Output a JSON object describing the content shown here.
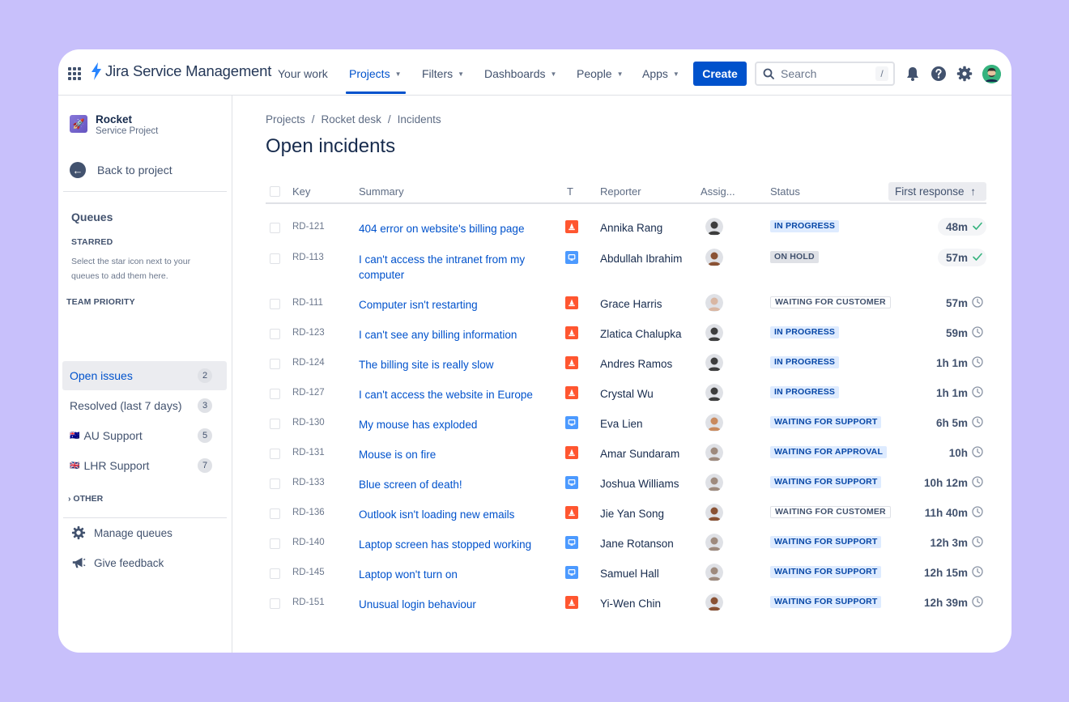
{
  "app": {
    "name": "Jira Service Management"
  },
  "nav": {
    "items": [
      {
        "label": "Your work",
        "caret": false,
        "active": false
      },
      {
        "label": "Projects",
        "caret": true,
        "active": true
      },
      {
        "label": "Filters",
        "caret": true,
        "active": false
      },
      {
        "label": "Dashboards",
        "caret": true,
        "active": false
      },
      {
        "label": "People",
        "caret": true,
        "active": false
      },
      {
        "label": "Apps",
        "caret": true,
        "active": false
      }
    ],
    "create_label": "Create",
    "search_placeholder": "Search",
    "search_shortcut": "/"
  },
  "sidebar": {
    "project_name": "Rocket",
    "project_type": "Service Project",
    "back_label": "Back to project",
    "queues_title": "Queues",
    "starred_caption": "STARRED",
    "starred_help": "Select the star icon next to your queues to add them here.",
    "team_priority_caption": "TEAM PRIORITY",
    "queues": [
      {
        "label": "Open issues",
        "count": "2",
        "flag": "",
        "selected": true
      },
      {
        "label": "Resolved (last 7 days)",
        "count": "3",
        "flag": "",
        "selected": false
      },
      {
        "label": "AU Support",
        "count": "5",
        "flag": "🇦🇺",
        "selected": false
      },
      {
        "label": "LHR Support",
        "count": "7",
        "flag": "🇬🇧",
        "selected": false
      }
    ],
    "other_label": "OTHER",
    "manage_label": "Manage queues",
    "feedback_label": "Give feedback"
  },
  "main": {
    "breadcrumb": [
      "Projects",
      "Rocket desk",
      "Incidents"
    ],
    "title": "Open incidents",
    "columns": {
      "key": "Key",
      "summary": "Summary",
      "type": "T",
      "reporter": "Reporter",
      "assignee": "Assig...",
      "status": "Status",
      "first_response": "First response"
    },
    "rows": [
      {
        "key": "RD-121",
        "summary": "404 error on website's billing page",
        "type": "incident",
        "reporter": "Annika Rang",
        "status": "IN PROGRESS",
        "status_style": "blue",
        "response": "48m",
        "met": true,
        "avatar": "#3d3d3d"
      },
      {
        "key": "RD-113",
        "summary": "I can't access the intranet from my computer",
        "type": "service",
        "reporter": "Abdullah Ibrahim",
        "status": "ON HOLD",
        "status_style": "grey",
        "response": "57m",
        "met": true,
        "avatar": "#8a5234"
      },
      {
        "key": "RD-111",
        "summary": "Computer isn't restarting",
        "type": "incident",
        "reporter": "Grace Harris",
        "status": "WAITING FOR CUSTOMER",
        "status_style": "outline",
        "response": "57m",
        "met": false,
        "avatar": "#d9b7a3"
      },
      {
        "key": "RD-123",
        "summary": "I can't see any billing information",
        "type": "incident",
        "reporter": "Zlatica Chalupka",
        "status": "IN PROGRESS",
        "status_style": "blue",
        "response": "59m",
        "met": false,
        "avatar": "#3d3d3d"
      },
      {
        "key": "RD-124",
        "summary": "The billing site is really slow",
        "type": "incident",
        "reporter": "Andres Ramos",
        "status": "IN PROGRESS",
        "status_style": "blue",
        "response": "1h 1m",
        "met": false,
        "avatar": "#3d3d3d"
      },
      {
        "key": "RD-127",
        "summary": "I can't access the website in Europe",
        "type": "incident",
        "reporter": "Crystal Wu",
        "status": "IN PROGRESS",
        "status_style": "blue",
        "response": "1h 1m",
        "met": false,
        "avatar": "#3d3d3d"
      },
      {
        "key": "RD-130",
        "summary": "My mouse has exploded",
        "type": "service",
        "reporter": "Eva Lien",
        "status": "WAITING FOR SUPPORT",
        "status_style": "blue",
        "response": "6h 5m",
        "met": false,
        "avatar": "#c98a5e"
      },
      {
        "key": "RD-131",
        "summary": "Mouse is on fire",
        "type": "incident",
        "reporter": "Amar Sundaram",
        "status": "WAITING FOR APPROVAL",
        "status_style": "blue",
        "response": "10h",
        "met": false,
        "avatar": "#9e8a7d"
      },
      {
        "key": "RD-133",
        "summary": "Blue screen of death!",
        "type": "service",
        "reporter": "Joshua Williams",
        "status": "WAITING FOR SUPPORT",
        "status_style": "blue",
        "response": "10h 12m",
        "met": false,
        "avatar": "#9e8a7d"
      },
      {
        "key": "RD-136",
        "summary": "Outlook isn't loading new emails",
        "type": "incident",
        "reporter": "Jie Yan Song",
        "status": "WAITING FOR CUSTOMER",
        "status_style": "outline",
        "response": "11h 40m",
        "met": false,
        "avatar": "#8a5234"
      },
      {
        "key": "RD-140",
        "summary": "Laptop screen has stopped working",
        "type": "service",
        "reporter": "Jane Rotanson",
        "status": "WAITING FOR SUPPORT",
        "status_style": "blue",
        "response": "12h 3m",
        "met": false,
        "avatar": "#9e8a7d"
      },
      {
        "key": "RD-145",
        "summary": "Laptop won't turn on",
        "type": "service",
        "reporter": "Samuel Hall",
        "status": "WAITING FOR SUPPORT",
        "status_style": "blue",
        "response": "12h 15m",
        "met": false,
        "avatar": "#9e8a7d"
      },
      {
        "key": "RD-151",
        "summary": "Unusual login behaviour",
        "type": "incident",
        "reporter": "Yi-Wen Chin",
        "status": "WAITING FOR SUPPORT",
        "status_style": "blue",
        "response": "12h 39m",
        "met": false,
        "avatar": "#8a5234"
      }
    ]
  },
  "colors": {
    "accent": "#0052cc",
    "background": "#c8c0fb",
    "incident": "#ff5630",
    "service": "#4c9aff",
    "met": "#36b37e"
  }
}
